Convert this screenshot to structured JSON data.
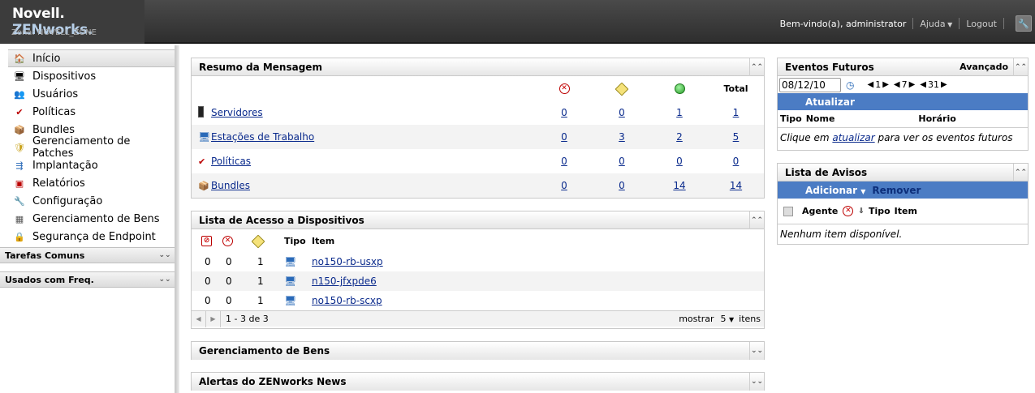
{
  "header": {
    "brand": "Novell.",
    "product": "ZENworks.",
    "zone": "Zona: NOVELL_ZONE",
    "welcome": "Bem-vindo(a), administrator",
    "help": "Ajuda",
    "logout": "Logout"
  },
  "sidebar": {
    "items": [
      {
        "label": "Início",
        "icon": "home-icon"
      },
      {
        "label": "Dispositivos",
        "icon": "monitor-icon"
      },
      {
        "label": "Usuários",
        "icon": "users-icon"
      },
      {
        "label": "Políticas",
        "icon": "policy-icon"
      },
      {
        "label": "Bundles",
        "icon": "bundle-icon"
      },
      {
        "label": "Gerenciamento de Patches",
        "icon": "shield-icon"
      },
      {
        "label": "Implantação",
        "icon": "deploy-icon"
      },
      {
        "label": "Relatórios",
        "icon": "report-icon"
      },
      {
        "label": "Configuração",
        "icon": "wrench-icon"
      },
      {
        "label": "Gerenciamento de Bens",
        "icon": "assets-icon"
      },
      {
        "label": "Segurança de Endpoint",
        "icon": "lock-icon"
      }
    ],
    "sections": [
      "Tarefas Comuns",
      "Usados com Freq."
    ]
  },
  "summary": {
    "title": "Resumo da Mensagem",
    "total_label": "Total",
    "rows": [
      {
        "label": "Servidores",
        "err": "0",
        "warn": "0",
        "ok": "1",
        "total": "1"
      },
      {
        "label": "Estações de Trabalho",
        "err": "0",
        "warn": "3",
        "ok": "2",
        "total": "5"
      },
      {
        "label": "Políticas",
        "err": "0",
        "warn": "0",
        "ok": "0",
        "total": "0"
      },
      {
        "label": "Bundles",
        "err": "0",
        "warn": "0",
        "ok": "14",
        "total": "14"
      }
    ]
  },
  "devices": {
    "title": "Lista de Acesso a Dispositivos",
    "col_type": "Tipo",
    "col_item": "Item",
    "rows": [
      {
        "a": "0",
        "b": "0",
        "c": "1",
        "item": "no150-rb-usxp"
      },
      {
        "a": "0",
        "b": "0",
        "c": "1",
        "item": "n150-jfxpde6"
      },
      {
        "a": "0",
        "b": "0",
        "c": "1",
        "item": "no150-rb-scxp"
      }
    ],
    "range": "1 - 3 de 3",
    "show": "mostrar",
    "page_size": "5",
    "items": "itens"
  },
  "collapsed": {
    "assets": "Gerenciamento de Bens",
    "news": "Alertas do ZENworks News"
  },
  "events": {
    "title": "Eventos Futuros",
    "advanced": "Avançado",
    "date": "08/12/10",
    "n1": "1",
    "n2": "7",
    "n3": "31",
    "refresh": "Atualizar",
    "col_type": "Tipo",
    "col_name": "Nome",
    "col_time": "Horário",
    "hint_pre": "Clique em",
    "hint_link": "atualizar",
    "hint_post": "para ver os eventos futuros"
  },
  "notices": {
    "title": "Lista de Avisos",
    "add": "Adicionar",
    "remove": "Remover",
    "col_agent": "Agente",
    "col_type": "Tipo",
    "col_item": "Item",
    "empty": "Nenhum item disponível."
  }
}
